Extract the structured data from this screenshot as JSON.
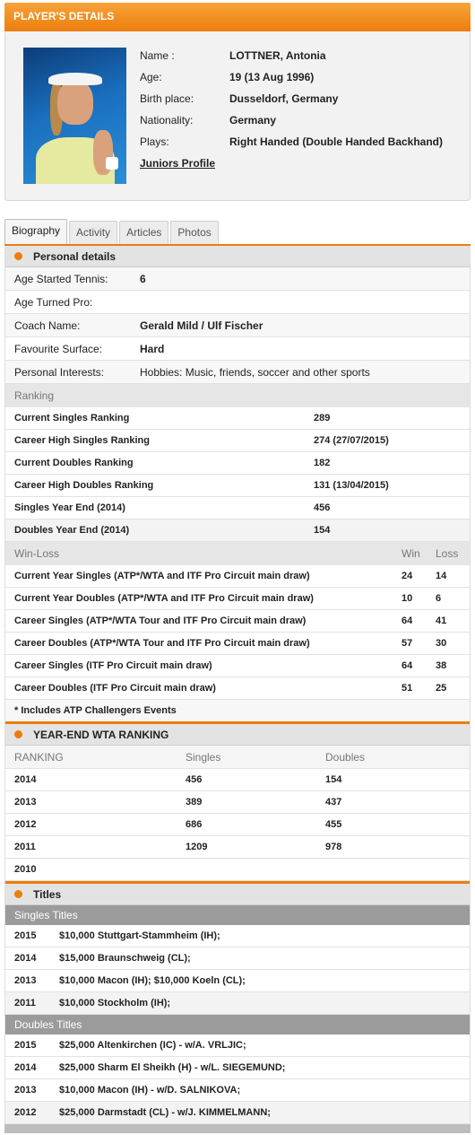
{
  "header": {
    "title": "PLAYER'S DETAILS"
  },
  "player": {
    "photo_icon": "player-photo",
    "fields": [
      {
        "label": "Name :",
        "value": "LOTTNER, Antonia"
      },
      {
        "label": "Age:",
        "value": "19 (13 Aug 1996)"
      },
      {
        "label": "Birth place:",
        "value": "Dusseldorf, Germany"
      },
      {
        "label": "Nationality:",
        "value": "Germany"
      },
      {
        "label": "Plays:",
        "value": "Right Handed (Double Handed Backhand)"
      }
    ],
    "juniors_link": "Juniors Profile"
  },
  "tabs": [
    {
      "label": "Biography",
      "active": true
    },
    {
      "label": "Activity",
      "active": false
    },
    {
      "label": "Articles",
      "active": false
    },
    {
      "label": "Photos",
      "active": false
    }
  ],
  "personal": {
    "title": "Personal details",
    "rows": [
      {
        "label": "Age Started Tennis:",
        "value": "6"
      },
      {
        "label": "Age Turned Pro:",
        "value": ""
      },
      {
        "label": "Coach Name:",
        "value": "Gerald Mild / Ulf Fischer"
      },
      {
        "label": "Favourite Surface:",
        "value": "Hard"
      },
      {
        "label": "Personal Interests:",
        "value": "Hobbies: Music, friends, soccer and other sports"
      }
    ]
  },
  "ranking": {
    "title": "Ranking",
    "rows": [
      {
        "label": "Current Singles Ranking",
        "value": "289"
      },
      {
        "label": "Career High Singles Ranking",
        "value": "274 (27/07/2015)"
      },
      {
        "label": "Current Doubles Ranking",
        "value": "182"
      },
      {
        "label": "Career High Doubles Ranking",
        "value": "131 (13/04/2015)"
      },
      {
        "label": "Singles Year End (2014)",
        "value": "456"
      },
      {
        "label": "Doubles Year End (2014)",
        "value": "154"
      }
    ]
  },
  "winloss": {
    "title": "Win-Loss",
    "win_header": "Win",
    "loss_header": "Loss",
    "rows": [
      {
        "label": "Current Year Singles (ATP*/WTA and ITF Pro Circuit main draw)",
        "win": "24",
        "loss": "14"
      },
      {
        "label": "Current Year Doubles (ATP*/WTA and ITF Pro Circuit main draw)",
        "win": "10",
        "loss": "6"
      },
      {
        "label": "Career Singles (ATP*/WTA Tour and ITF Pro Circuit main draw)",
        "win": "64",
        "loss": "41"
      },
      {
        "label": "Career Doubles (ATP*/WTA Tour and ITF Pro Circuit main draw)",
        "win": "57",
        "loss": "30"
      },
      {
        "label": "Career Singles (ITF Pro Circuit main draw)",
        "win": "64",
        "loss": "38"
      },
      {
        "label": "Career Doubles (ITF Pro Circuit main draw)",
        "win": "51",
        "loss": "25"
      }
    ],
    "note": "* Includes ATP Challengers Events"
  },
  "yearend": {
    "title": "YEAR-END WTA RANKING",
    "headers": [
      "RANKING",
      "Singles",
      "Doubles"
    ],
    "rows": [
      {
        "year": "2014",
        "singles": "456",
        "doubles": "154"
      },
      {
        "year": "2013",
        "singles": "389",
        "doubles": "437"
      },
      {
        "year": "2012",
        "singles": "686",
        "doubles": "455"
      },
      {
        "year": "2011",
        "singles": "1209",
        "doubles": "978"
      },
      {
        "year": "2010",
        "singles": "",
        "doubles": ""
      }
    ]
  },
  "titles": {
    "title": "Titles",
    "singles_header": "Singles Titles",
    "singles": [
      {
        "year": "2015",
        "text": "$10,000 Stuttgart-Stammheim (IH);"
      },
      {
        "year": "2014",
        "text": "$15,000 Braunschweig (CL);"
      },
      {
        "year": "2013",
        "text": "$10,000 Macon (IH); $10,000 Koeln (CL);"
      },
      {
        "year": "2011",
        "text": "$10,000 Stockholm (IH);"
      }
    ],
    "doubles_header": "Doubles Titles",
    "doubles": [
      {
        "year": "2015",
        "text": "$25,000 Altenkirchen (IC) - w/A. VRLJIC;"
      },
      {
        "year": "2014",
        "text": "$25,000 Sharm El Sheikh (H) - w/L. SIEGEMUND;"
      },
      {
        "year": "2013",
        "text": "$10,000 Macon (IH) - w/D. SALNIKOVA;"
      },
      {
        "year": "2012",
        "text": "$25,000 Darmstadt (CL) - w/J. KIMMELMANN;"
      }
    ]
  },
  "colors": {
    "accent": "#ec7d0d",
    "section_bg": "#e3e3e3",
    "titles_bar": "#9b9b9b"
  }
}
